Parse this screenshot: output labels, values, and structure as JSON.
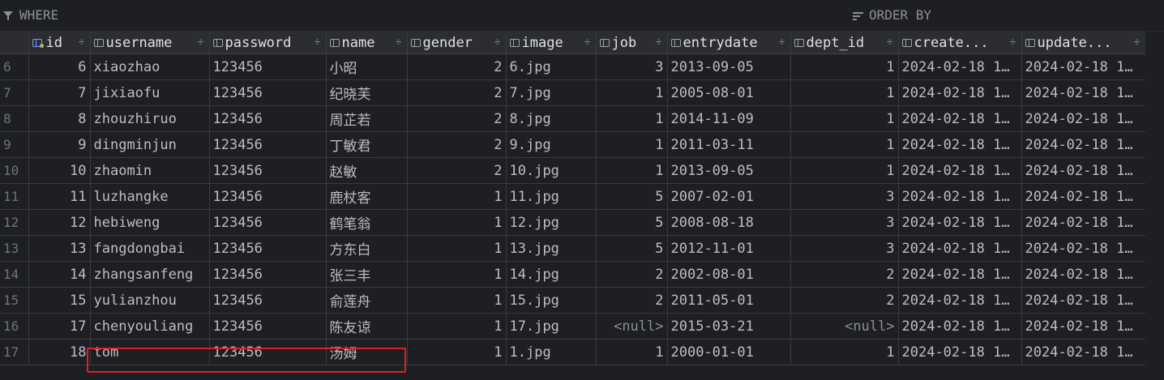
{
  "filter": {
    "where_label": "WHERE",
    "order_label": "ORDER BY"
  },
  "columns": [
    {
      "label": "id",
      "icon": "primary-key-column-icon"
    },
    {
      "label": "username",
      "icon": "column-icon"
    },
    {
      "label": "password",
      "icon": "column-icon"
    },
    {
      "label": "name",
      "icon": "column-icon"
    },
    {
      "label": "gender",
      "icon": "column-icon"
    },
    {
      "label": "image",
      "icon": "column-icon"
    },
    {
      "label": "job",
      "icon": "column-icon"
    },
    {
      "label": "entrydate",
      "icon": "column-icon"
    },
    {
      "label": "dept_id",
      "icon": "column-icon"
    },
    {
      "label": "create...",
      "icon": "column-icon"
    },
    {
      "label": "update...",
      "icon": "column-icon"
    }
  ],
  "sort_glyph": "÷",
  "rows": [
    {
      "n": "6",
      "id": "6",
      "username": "xiaozhao",
      "password": "123456",
      "name": "小昭",
      "gender": "2",
      "image": "6.jpg",
      "job": "3",
      "entrydate": "2013-09-05",
      "dept_id": "1",
      "create": "2024-02-18 1…",
      "update": "2024-02-18 1…"
    },
    {
      "n": "7",
      "id": "7",
      "username": "jixiaofu",
      "password": "123456",
      "name": "纪晓芙",
      "gender": "2",
      "image": "7.jpg",
      "job": "1",
      "entrydate": "2005-08-01",
      "dept_id": "1",
      "create": "2024-02-18 1…",
      "update": "2024-02-18 1…"
    },
    {
      "n": "8",
      "id": "8",
      "username": "zhouzhiruo",
      "password": "123456",
      "name": "周芷若",
      "gender": "2",
      "image": "8.jpg",
      "job": "1",
      "entrydate": "2014-11-09",
      "dept_id": "1",
      "create": "2024-02-18 1…",
      "update": "2024-02-18 1…"
    },
    {
      "n": "9",
      "id": "9",
      "username": "dingminjun",
      "password": "123456",
      "name": "丁敏君",
      "gender": "2",
      "image": "9.jpg",
      "job": "1",
      "entrydate": "2011-03-11",
      "dept_id": "1",
      "create": "2024-02-18 1…",
      "update": "2024-02-18 1…"
    },
    {
      "n": "10",
      "id": "10",
      "username": "zhaomin",
      "password": "123456",
      "name": "赵敏",
      "gender": "2",
      "image": "10.jpg",
      "job": "1",
      "entrydate": "2013-09-05",
      "dept_id": "1",
      "create": "2024-02-18 1…",
      "update": "2024-02-18 1…"
    },
    {
      "n": "11",
      "id": "11",
      "username": "luzhangke",
      "password": "123456",
      "name": "鹿杖客",
      "gender": "1",
      "image": "11.jpg",
      "job": "5",
      "entrydate": "2007-02-01",
      "dept_id": "3",
      "create": "2024-02-18 1…",
      "update": "2024-02-18 1…"
    },
    {
      "n": "12",
      "id": "12",
      "username": "hebiweng",
      "password": "123456",
      "name": "鹤笔翁",
      "gender": "1",
      "image": "12.jpg",
      "job": "5",
      "entrydate": "2008-08-18",
      "dept_id": "3",
      "create": "2024-02-18 1…",
      "update": "2024-02-18 1…"
    },
    {
      "n": "13",
      "id": "13",
      "username": "fangdongbai",
      "password": "123456",
      "name": "方东白",
      "gender": "1",
      "image": "13.jpg",
      "job": "5",
      "entrydate": "2012-11-01",
      "dept_id": "3",
      "create": "2024-02-18 1…",
      "update": "2024-02-18 1…"
    },
    {
      "n": "14",
      "id": "14",
      "username": "zhangsanfeng",
      "password": "123456",
      "name": "张三丰",
      "gender": "1",
      "image": "14.jpg",
      "job": "2",
      "entrydate": "2002-08-01",
      "dept_id": "2",
      "create": "2024-02-18 1…",
      "update": "2024-02-18 1…"
    },
    {
      "n": "15",
      "id": "15",
      "username": "yulianzhou",
      "password": "123456",
      "name": "俞莲舟",
      "gender": "1",
      "image": "15.jpg",
      "job": "2",
      "entrydate": "2011-05-01",
      "dept_id": "2",
      "create": "2024-02-18 1…",
      "update": "2024-02-18 1…"
    },
    {
      "n": "16",
      "id": "17",
      "username": "chenyouliang",
      "password": "123456",
      "name": "陈友谅",
      "gender": "1",
      "image": "17.jpg",
      "job": "<null>",
      "entrydate": "2015-03-21",
      "dept_id": "<null>",
      "create": "2024-02-18 1…",
      "update": "2024-02-18 1…"
    },
    {
      "n": "17",
      "id": "18",
      "username": "tom",
      "password": "123456",
      "name": "汤姆",
      "gender": "1",
      "image": "1.jpg",
      "job": "1",
      "entrydate": "2000-01-01",
      "dept_id": "1",
      "create": "2024-02-18 1…",
      "update": "2024-02-18 1…"
    }
  ]
}
